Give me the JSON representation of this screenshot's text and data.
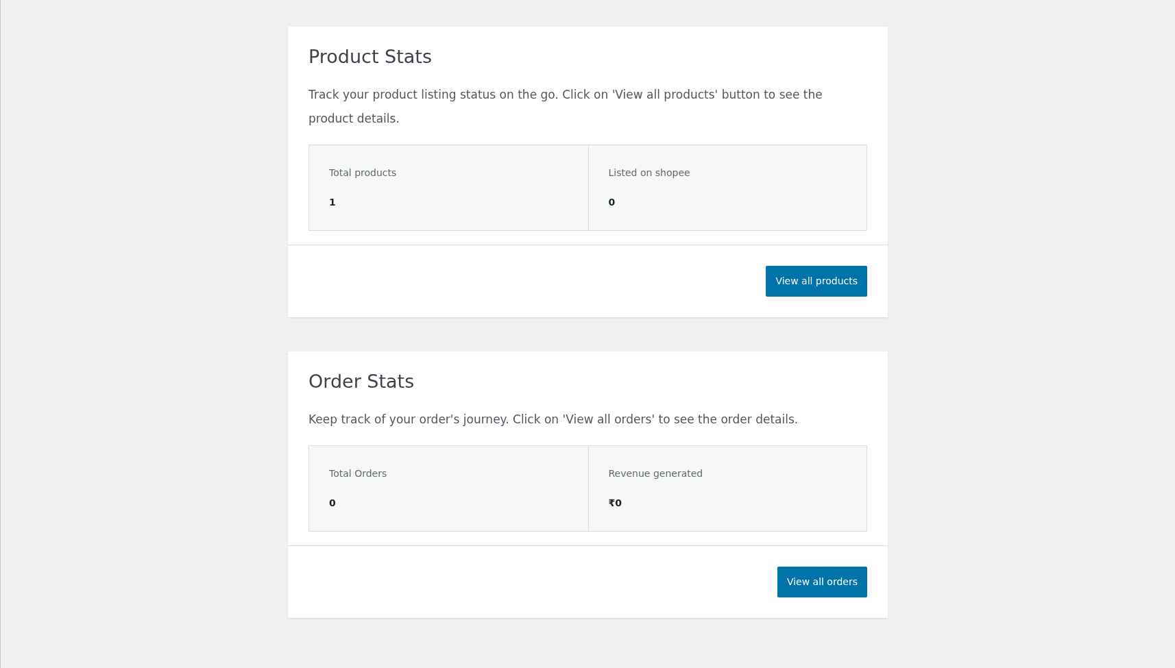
{
  "cards": [
    {
      "title": "Product Stats",
      "description": "Track your product listing status on the go. Click on 'View all products' button to see the product details.",
      "stats": [
        {
          "label": "Total products",
          "value": "1"
        },
        {
          "label": "Listed on shopee",
          "value": "0"
        }
      ],
      "button": "View all products"
    },
    {
      "title": "Order Stats",
      "description": "Keep track of your order's journey. Click on 'View all orders' to see the order details.",
      "stats": [
        {
          "label": "Total Orders",
          "value": "0"
        },
        {
          "label": "Revenue generated",
          "value": "₹0"
        }
      ],
      "button": "View all orders"
    }
  ]
}
